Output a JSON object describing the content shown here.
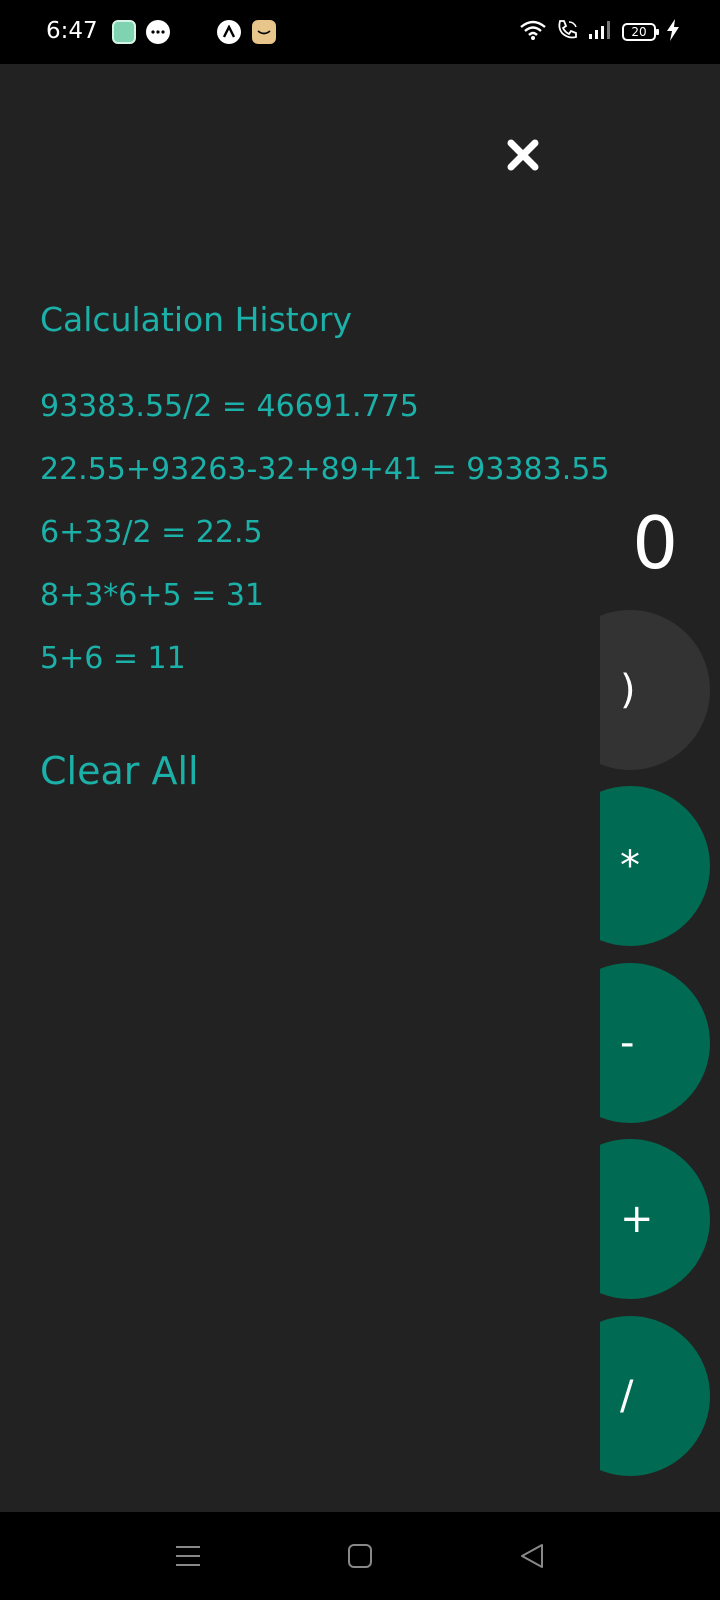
{
  "status_bar": {
    "time": "6:47",
    "battery_level": "20",
    "icons": [
      "stack-app-icon",
      "message-bubble-icon",
      "arrow-up-app-icon",
      "amazon-box-icon",
      "wifi-icon",
      "wifi-call-icon",
      "signal-icon",
      "battery-icon",
      "charging-bolt-icon"
    ]
  },
  "history": {
    "title": "Calculation History",
    "items": [
      "93383.55/2 = 46691.775",
      "22.55+93263-32+89+41 = 93383.55",
      "6+33/2 = 22.5",
      "8+3*6+5 = 31",
      "5+6 = 11"
    ],
    "clear_label": "Clear All"
  },
  "calculator": {
    "display": "0",
    "keys": [
      ")",
      "*",
      "-",
      "+",
      "/"
    ]
  },
  "colors": {
    "background": "#222222",
    "accent_text": "#1bb0a8",
    "operator_key": "#006b52",
    "paren_key": "#333333"
  },
  "navigation": {
    "icons": [
      "menu-icon",
      "home-square-icon",
      "back-triangle-icon"
    ]
  }
}
